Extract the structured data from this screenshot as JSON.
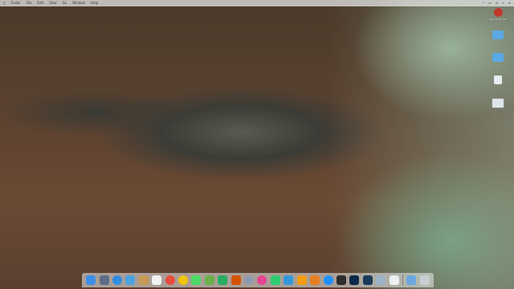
{
  "menubar": {
    "apple_icon": "apple-icon",
    "items": [
      "Finder",
      "File",
      "Edit",
      "View",
      "Go",
      "Window",
      "Help"
    ],
    "right_items": [
      "wifi-icon",
      "battery-icon",
      "clock-icon",
      "search-icon",
      "menu-icon"
    ]
  },
  "desktop_icons": [
    {
      "icon": "hard-drive-icon",
      "label": "Macintosh HD",
      "color": "#c0392b"
    },
    {
      "icon": "folder-icon",
      "label": "",
      "color": "#5aa9e6"
    },
    {
      "icon": "folder-icon",
      "label": "",
      "color": "#5aa9e6"
    },
    {
      "icon": "document-icon",
      "label": "",
      "color": "#e6eef2"
    },
    {
      "icon": "screenshot-icon",
      "label": "",
      "color": "#dfe6ea"
    }
  ],
  "dock": {
    "items": [
      {
        "icon": "finder-icon",
        "color": "#3d8ee6"
      },
      {
        "icon": "launchpad-icon",
        "color": "#5b6d86"
      },
      {
        "icon": "safari-icon",
        "color": "#2f8de0"
      },
      {
        "icon": "mail-icon",
        "color": "#4aa3df"
      },
      {
        "icon": "notes-icon",
        "color": "#c79a55"
      },
      {
        "icon": "calendar-icon",
        "color": "#f2f2f2"
      },
      {
        "icon": "chrome-icon",
        "color": "#e74c3c"
      },
      {
        "icon": "photos-icon",
        "color": "#f1c40f"
      },
      {
        "icon": "messages-icon",
        "color": "#4cd964"
      },
      {
        "icon": "maps-icon",
        "color": "#6ab04c"
      },
      {
        "icon": "facetime-icon",
        "color": "#27ae60"
      },
      {
        "icon": "contacts-icon",
        "color": "#d35400"
      },
      {
        "icon": "preferences-icon",
        "color": "#8e9aaf"
      },
      {
        "icon": "itunes-icon",
        "color": "#e84393"
      },
      {
        "icon": "numbers-icon",
        "color": "#2ecc71"
      },
      {
        "icon": "keynote-icon",
        "color": "#3498db"
      },
      {
        "icon": "pages-icon",
        "color": "#f39c12"
      },
      {
        "icon": "ibooks-icon",
        "color": "#e67e22"
      },
      {
        "icon": "appstore-icon",
        "color": "#1e90ff"
      },
      {
        "icon": "terminal-icon",
        "color": "#2d2d2d"
      },
      {
        "icon": "photoshop-icon",
        "color": "#0b2a4a"
      },
      {
        "icon": "lightroom-icon",
        "color": "#1b3a5a"
      },
      {
        "icon": "preview-icon",
        "color": "#9fb3c8"
      },
      {
        "icon": "textedit-icon",
        "color": "#ecf0f1"
      }
    ],
    "trailing": [
      {
        "icon": "downloads-folder-icon",
        "color": "#6aa8e0"
      },
      {
        "icon": "trash-icon",
        "color": "#c8ced3"
      }
    ]
  },
  "wallpaper": {
    "accent": "#5e4330"
  }
}
